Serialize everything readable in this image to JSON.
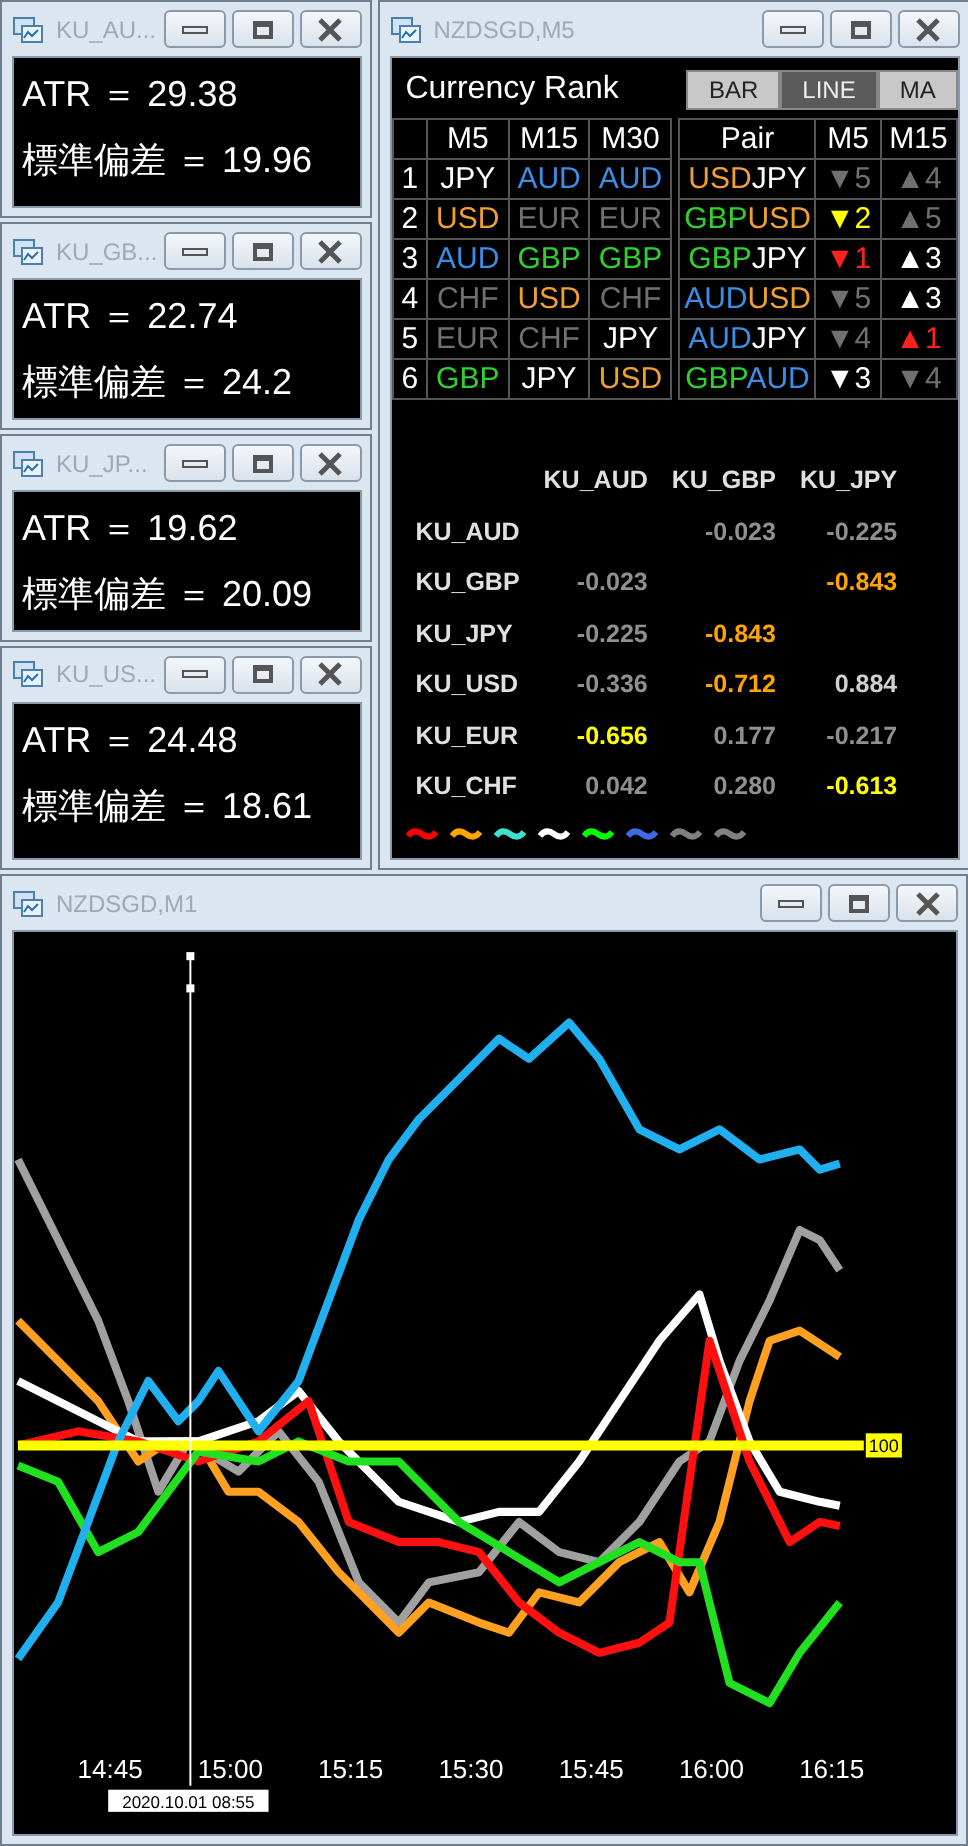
{
  "mini_windows": [
    {
      "title": "KU_AU...",
      "lines": [
        "ATR ＝ 29.38",
        "標準偏差 ＝ 19.96"
      ]
    },
    {
      "title": "KU_GB...",
      "lines": [
        "ATR ＝ 22.74",
        "標準偏差 ＝ 24.2"
      ]
    },
    {
      "title": "KU_JP...",
      "lines": [
        "ATR ＝ 19.62",
        "標準偏差 ＝ 20.09"
      ]
    },
    {
      "title": "KU_US...",
      "lines": [
        "ATR ＝ 24.48",
        "標準偏差 ＝ 18.61"
      ]
    }
  ],
  "rank_window": {
    "title": "NZDSGD,M5",
    "heading": "Currency Rank",
    "mode_buttons": [
      {
        "label": "BAR",
        "selected": false
      },
      {
        "label": "LINE",
        "selected": true
      },
      {
        "label": "MA",
        "selected": false
      }
    ],
    "rank_columns": [
      "M5",
      "M15",
      "M30"
    ],
    "rank_rows": [
      {
        "rank": "1",
        "cells": [
          {
            "text": "JPY",
            "color": "#ffffff"
          },
          {
            "text": "AUD",
            "color": "#3a8ee6"
          },
          {
            "text": "AUD",
            "color": "#3a8ee6"
          }
        ]
      },
      {
        "rank": "2",
        "cells": [
          {
            "text": "USD",
            "color": "#f0a030"
          },
          {
            "text": "EUR",
            "color": "#707070"
          },
          {
            "text": "EUR",
            "color": "#707070"
          }
        ]
      },
      {
        "rank": "3",
        "cells": [
          {
            "text": "AUD",
            "color": "#3a8ee6"
          },
          {
            "text": "GBP",
            "color": "#30d030"
          },
          {
            "text": "GBP",
            "color": "#30d030"
          }
        ]
      },
      {
        "rank": "4",
        "cells": [
          {
            "text": "CHF",
            "color": "#707070"
          },
          {
            "text": "USD",
            "color": "#f0a030"
          },
          {
            "text": "CHF",
            "color": "#707070"
          }
        ]
      },
      {
        "rank": "5",
        "cells": [
          {
            "text": "EUR",
            "color": "#707070"
          },
          {
            "text": "CHF",
            "color": "#707070"
          },
          {
            "text": "JPY",
            "color": "#ffffff"
          }
        ]
      },
      {
        "rank": "6",
        "cells": [
          {
            "text": "GBP",
            "color": "#30d030"
          },
          {
            "text": "JPY",
            "color": "#ffffff"
          },
          {
            "text": "USD",
            "color": "#f0a030"
          }
        ]
      }
    ],
    "pair_columns": [
      "Pair",
      "M5",
      "M15"
    ],
    "pair_rows": [
      {
        "pair": [
          {
            "text": "USD",
            "color": "#f0a030"
          },
          {
            "text": "JPY",
            "color": "#ffffff"
          }
        ],
        "trends": [
          {
            "text": "▼5",
            "color": "#707070"
          },
          {
            "text": "▲4",
            "color": "#707070"
          }
        ]
      },
      {
        "pair": [
          {
            "text": "GBP",
            "color": "#30d030"
          },
          {
            "text": "USD",
            "color": "#f0a030"
          }
        ],
        "trends": [
          {
            "text": "▼2",
            "color": "#ffff00"
          },
          {
            "text": "▲5",
            "color": "#707070"
          }
        ]
      },
      {
        "pair": [
          {
            "text": "GBP",
            "color": "#30d030"
          },
          {
            "text": "JPY",
            "color": "#ffffff"
          }
        ],
        "trends": [
          {
            "text": "▼1",
            "color": "#ff2020"
          },
          {
            "text": "▲3",
            "color": "#ffffff"
          }
        ]
      },
      {
        "pair": [
          {
            "text": "AUD",
            "color": "#3a8ee6"
          },
          {
            "text": "USD",
            "color": "#f0a030"
          }
        ],
        "trends": [
          {
            "text": "▼5",
            "color": "#707070"
          },
          {
            "text": "▲3",
            "color": "#ffffff"
          }
        ]
      },
      {
        "pair": [
          {
            "text": "AUD",
            "color": "#3a8ee6"
          },
          {
            "text": "JPY",
            "color": "#ffffff"
          }
        ],
        "trends": [
          {
            "text": "▼4",
            "color": "#707070"
          },
          {
            "text": "▲1",
            "color": "#ff2020"
          }
        ]
      },
      {
        "pair": [
          {
            "text": "GBP",
            "color": "#30d030"
          },
          {
            "text": "AUD",
            "color": "#3a8ee6"
          }
        ],
        "trends": [
          {
            "text": "▼3",
            "color": "#ffffff"
          },
          {
            "text": "▼4",
            "color": "#707070"
          }
        ]
      }
    ],
    "corr_columns": [
      "KU_AUD",
      "KU_GBP",
      "KU_JPY"
    ],
    "corr_rows": [
      {
        "label": "KU_AUD",
        "values": [
          {
            "text": "-0.023",
            "color": "#909090"
          },
          {
            "text": "-0.225",
            "color": "#909090"
          }
        ]
      },
      {
        "label": "KU_GBP",
        "values": [
          {
            "text": "-0.023",
            "color": "#909090"
          },
          {
            "text": "-0.843",
            "color": "#ffa500"
          }
        ]
      },
      {
        "label": "KU_JPY",
        "values": [
          {
            "text": "-0.225",
            "color": "#909090"
          },
          {
            "text": "-0.843",
            "color": "#ffa500"
          }
        ]
      },
      {
        "label": "KU_USD",
        "values": [
          {
            "text": "-0.336",
            "color": "#909090"
          },
          {
            "text": "-0.712",
            "color": "#ffa500"
          },
          {
            "text": "0.884",
            "color": "#d0d0d0"
          }
        ]
      },
      {
        "label": "KU_EUR",
        "values": [
          {
            "text": "-0.656",
            "color": "#ffff00"
          },
          {
            "text": "0.177",
            "color": "#909090"
          },
          {
            "text": "-0.217",
            "color": "#909090"
          }
        ]
      },
      {
        "label": "KU_CHF",
        "values": [
          {
            "text": "0.042",
            "color": "#909090"
          },
          {
            "text": "0.280",
            "color": "#909090"
          },
          {
            "text": "-0.613",
            "color": "#ffff00"
          }
        ]
      }
    ],
    "legend": [
      {
        "color": "#ff0000"
      },
      {
        "color": "#ffa500"
      },
      {
        "color": "#40e0d0"
      },
      {
        "color": "#ffffff"
      },
      {
        "color": "#00ff00"
      },
      {
        "color": "#4169e1"
      },
      {
        "color": "#808080"
      },
      {
        "color": "#808080"
      }
    ]
  },
  "chart_window": {
    "title": "NZDSGD,M1",
    "level_label": "100",
    "time_labels": [
      "14:45",
      "15:00",
      "15:15",
      "15:30",
      "15:45",
      "16:00",
      "16:15"
    ],
    "cursor_time": "2020.10.01 08:55"
  }
}
